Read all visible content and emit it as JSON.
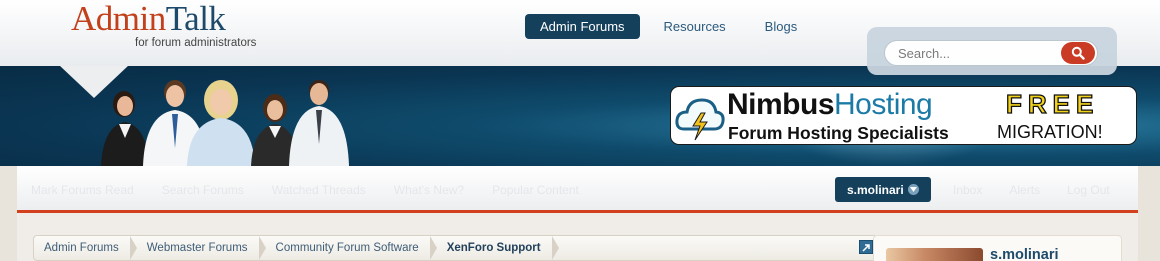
{
  "logo": {
    "name_part1": "Admin",
    "name_part2": "Talk",
    "tagline": "for forum administrators"
  },
  "topnav": {
    "tabs": [
      {
        "label": "Admin Forums",
        "active": true
      },
      {
        "label": "Resources",
        "active": false
      },
      {
        "label": "Blogs",
        "active": false
      }
    ]
  },
  "search": {
    "placeholder": "Search..."
  },
  "ad": {
    "brand_dark": "Nimbus",
    "brand_light": "Hosting",
    "subtitle": "Forum Hosting Specialists",
    "free": "FREE",
    "migration": "MIGRATION!"
  },
  "navbar": {
    "links": [
      "Mark Forums Read",
      "Search Forums",
      "Watched Threads",
      "What's New?",
      "Popular Content"
    ],
    "user": "s.molinari",
    "right_links": [
      "Inbox",
      "Alerts",
      "Log Out"
    ]
  },
  "breadcrumbs": [
    "Admin Forums",
    "Webmaster Forums",
    "Community Forum Software",
    "XenForo Support"
  ],
  "sidebar": {
    "username": "s.molinari"
  },
  "colors": {
    "accent": "#15405c",
    "brand_red": "#c2401a",
    "nav_border": "#d2401e"
  }
}
